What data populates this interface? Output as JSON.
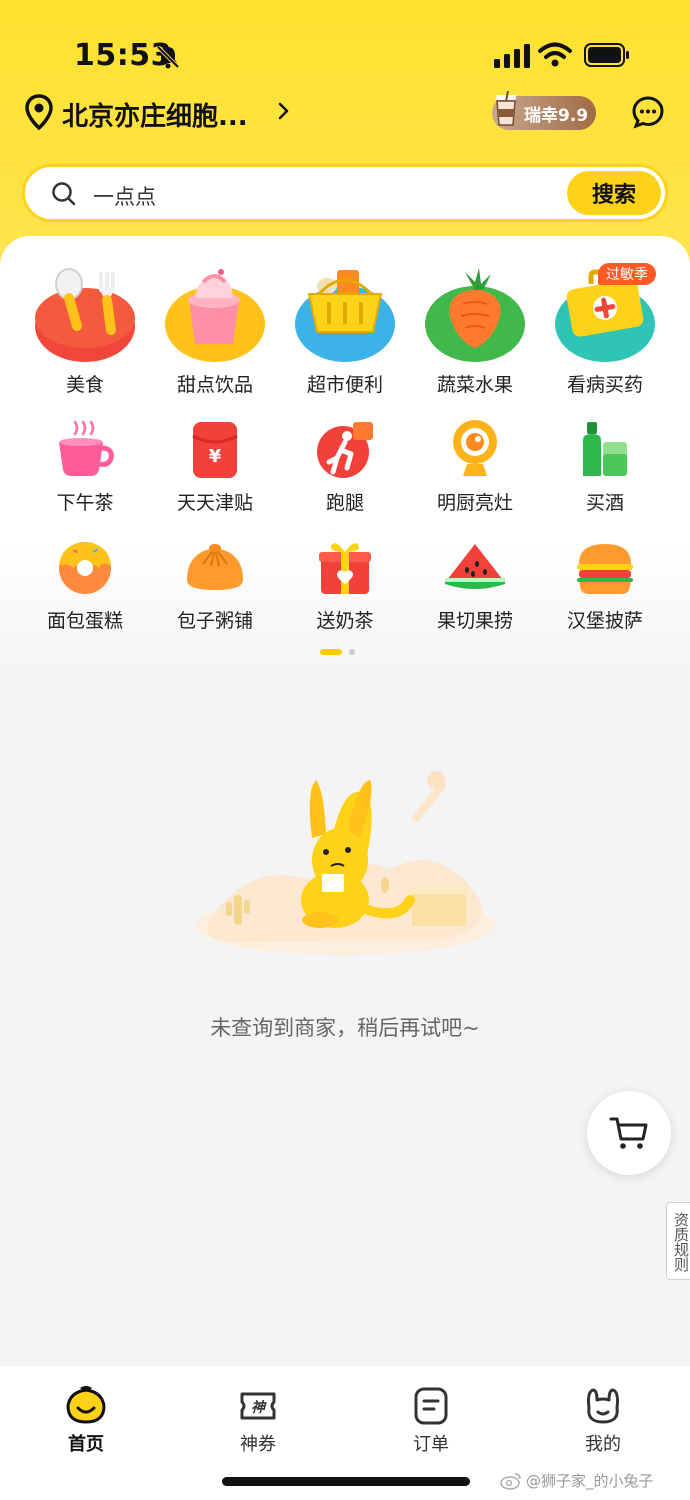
{
  "status_bar": {
    "time": "15:53"
  },
  "location": {
    "text": "北京亦庄细胞..."
  },
  "promo": {
    "label": "瑞幸9.9"
  },
  "search": {
    "query": "一点点",
    "button_label": "搜索"
  },
  "categories_row1": [
    {
      "label": "美食",
      "icon": "food-utensils-icon"
    },
    {
      "label": "甜点饮品",
      "icon": "dessert-drink-icon"
    },
    {
      "label": "超市便利",
      "icon": "supermarket-basket-icon"
    },
    {
      "label": "蔬菜水果",
      "icon": "vegetable-fruit-icon"
    },
    {
      "label": "看病买药",
      "icon": "medicine-kit-icon",
      "badge": "过敏季"
    }
  ],
  "categories_row2": [
    {
      "label": "下午茶",
      "icon": "teacup-icon"
    },
    {
      "label": "天天津贴",
      "icon": "red-envelope-icon"
    },
    {
      "label": "跑腿",
      "icon": "errand-runner-icon"
    },
    {
      "label": "明厨亮灶",
      "icon": "camera-icon"
    },
    {
      "label": "买酒",
      "icon": "liquor-bottle-icon"
    }
  ],
  "categories_row3": [
    {
      "label": "面包蛋糕",
      "icon": "donut-icon"
    },
    {
      "label": "包子粥铺",
      "icon": "bun-icon"
    },
    {
      "label": "送奶茶",
      "icon": "gift-box-icon"
    },
    {
      "label": "果切果捞",
      "icon": "watermelon-icon"
    },
    {
      "label": "汉堡披萨",
      "icon": "burger-icon"
    }
  ],
  "empty_state": {
    "message": "未查询到商家，稍后再试吧~"
  },
  "side_tab": {
    "label": "资质规则"
  },
  "bottom_nav": [
    {
      "label": "首页",
      "icon": "home-icon",
      "active": true
    },
    {
      "label": "神券",
      "icon": "coupon-icon",
      "active": false
    },
    {
      "label": "订单",
      "icon": "order-icon",
      "active": false
    },
    {
      "label": "我的",
      "icon": "profile-icon",
      "active": false
    }
  ],
  "watermark": {
    "text": "@狮子家_的小兔子"
  },
  "colors": {
    "brand_yellow": "#ffd21a",
    "badge_orange": "#ff5a26"
  }
}
